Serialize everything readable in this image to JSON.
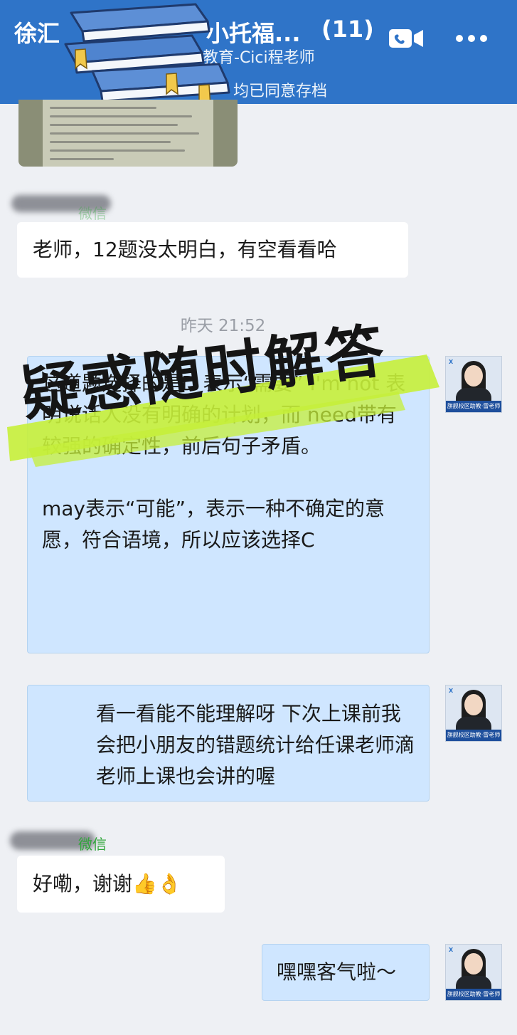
{
  "header": {
    "title_left": "徐汇",
    "title_right": "小托福...",
    "member_count": "(11)",
    "subtitle": "教育-Cici程老师",
    "notice": "均已同意存档"
  },
  "messages": {
    "m1_sender": "微信",
    "m1_text": "老师，12题没太明白，有空看看哈",
    "timestamp": "昨天 21:52",
    "m2_text": "这道题选择的是D 表示“需要” I'm not 表明说话人没有明确的计划，而 need带有较强的确定性，前后句子矛盾。\n\nmay表示“可能”，表示一种不确定的意愿，符合语境，所以应该选择C",
    "m3_text": "看一看能不能理解呀 下次上课前我会把小朋友的错题统计给任课老师滴 老师上课也会讲的喔",
    "m4_sender": "微信",
    "m4_text": "好嘞，谢谢👍👌",
    "m5_text": "嘿嘿客气啦～"
  },
  "avatar": {
    "caption": "旗舰校区助教·雷老师",
    "logo": "X"
  },
  "stamp": {
    "text": "疑惑随时解答"
  },
  "colors": {
    "header_bg": "#2f74c8",
    "my_bubble": "#cfe6ff",
    "stamp_stroke": "#c6ef3a",
    "sender_green": "#31a63b"
  }
}
